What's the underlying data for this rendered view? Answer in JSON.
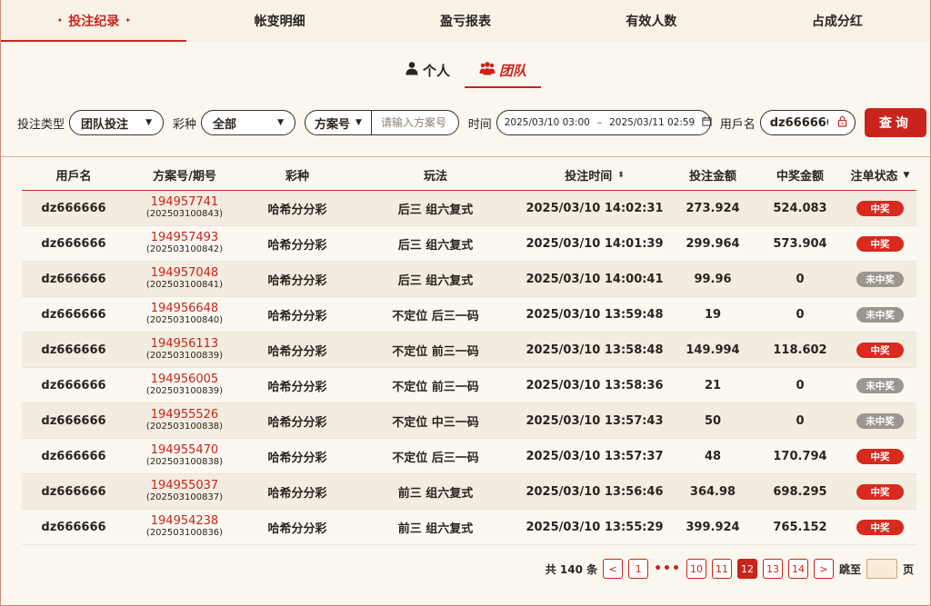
{
  "top_tabs": [
    {
      "label": "投注纪录",
      "active": true
    },
    {
      "label": "帐变明细",
      "active": false
    },
    {
      "label": "盈亏报表",
      "active": false
    },
    {
      "label": "有效人数",
      "active": false
    },
    {
      "label": "占成分红",
      "active": false
    }
  ],
  "sub_tabs": [
    {
      "label": "个人",
      "icon": "user-icon",
      "active": false
    },
    {
      "label": "团队",
      "icon": "team-icon",
      "active": true
    }
  ],
  "filters": {
    "bet_type_label": "投注类型",
    "bet_type_value": "团队投注",
    "lottery_label": "彩种",
    "lottery_value": "全部",
    "plan_select": "方案号",
    "plan_placeholder": "请输入方案号",
    "time_label": "时间",
    "time_start": "2025/03/10 03:00",
    "time_sep": "–",
    "time_end": "2025/03/11 02:59",
    "user_label": "用戶名",
    "user_value": "dz666666",
    "query_label": "查询"
  },
  "table": {
    "headers": [
      "用戶名",
      "方案号/期号",
      "彩种",
      "玩法",
      "投注时间",
      "投注金额",
      "中奖金额",
      "注单状态"
    ],
    "rows": [
      {
        "user": "dz666666",
        "plan": "194957741",
        "period": "(202503100843)",
        "lottery": "哈希分分彩",
        "play": "后三 组六复式",
        "time": "2025/03/10 14:02:31",
        "amount": "273.924",
        "prize": "524.083",
        "status": "中奖",
        "win": true
      },
      {
        "user": "dz666666",
        "plan": "194957493",
        "period": "(202503100842)",
        "lottery": "哈希分分彩",
        "play": "后三 组六复式",
        "time": "2025/03/10 14:01:39",
        "amount": "299.964",
        "prize": "573.904",
        "status": "中奖",
        "win": true
      },
      {
        "user": "dz666666",
        "plan": "194957048",
        "period": "(202503100841)",
        "lottery": "哈希分分彩",
        "play": "后三 组六复式",
        "time": "2025/03/10 14:00:41",
        "amount": "99.96",
        "prize": "0",
        "status": "未中奖",
        "win": false
      },
      {
        "user": "dz666666",
        "plan": "194956648",
        "period": "(202503100840)",
        "lottery": "哈希分分彩",
        "play": "不定位 后三一码",
        "time": "2025/03/10 13:59:48",
        "amount": "19",
        "prize": "0",
        "status": "未中奖",
        "win": false
      },
      {
        "user": "dz666666",
        "plan": "194956113",
        "period": "(202503100839)",
        "lottery": "哈希分分彩",
        "play": "不定位 前三一码",
        "time": "2025/03/10 13:58:48",
        "amount": "149.994",
        "prize": "118.602",
        "status": "中奖",
        "win": true
      },
      {
        "user": "dz666666",
        "plan": "194956005",
        "period": "(202503100839)",
        "lottery": "哈希分分彩",
        "play": "不定位 前三一码",
        "time": "2025/03/10 13:58:36",
        "amount": "21",
        "prize": "0",
        "status": "未中奖",
        "win": false
      },
      {
        "user": "dz666666",
        "plan": "194955526",
        "period": "(202503100838)",
        "lottery": "哈希分分彩",
        "play": "不定位 中三一码",
        "time": "2025/03/10 13:57:43",
        "amount": "50",
        "prize": "0",
        "status": "未中奖",
        "win": false
      },
      {
        "user": "dz666666",
        "plan": "194955470",
        "period": "(202503100838)",
        "lottery": "哈希分分彩",
        "play": "不定位 后三一码",
        "time": "2025/03/10 13:57:37",
        "amount": "48",
        "prize": "170.794",
        "status": "中奖",
        "win": true
      },
      {
        "user": "dz666666",
        "plan": "194955037",
        "period": "(202503100837)",
        "lottery": "哈希分分彩",
        "play": "前三 组六复式",
        "time": "2025/03/10 13:56:46",
        "amount": "364.98",
        "prize": "698.295",
        "status": "中奖",
        "win": true
      },
      {
        "user": "dz666666",
        "plan": "194954238",
        "period": "(202503100836)",
        "lottery": "哈希分分彩",
        "play": "前三 组六复式",
        "time": "2025/03/10 13:55:29",
        "amount": "399.924",
        "prize": "765.152",
        "status": "中奖",
        "win": true
      }
    ]
  },
  "pagination": {
    "total_text": "共 140 条",
    "prev": "<",
    "first": "1",
    "ellipsis": "•••",
    "pages": [
      "10",
      "11",
      "12",
      "13",
      "14"
    ],
    "current": "12",
    "next": ">",
    "jump_label": "跳至",
    "page_unit": "页"
  },
  "colors": {
    "accent": "#c8241b",
    "lose_badge": "#9c9590",
    "background": "#fbf7ee"
  }
}
